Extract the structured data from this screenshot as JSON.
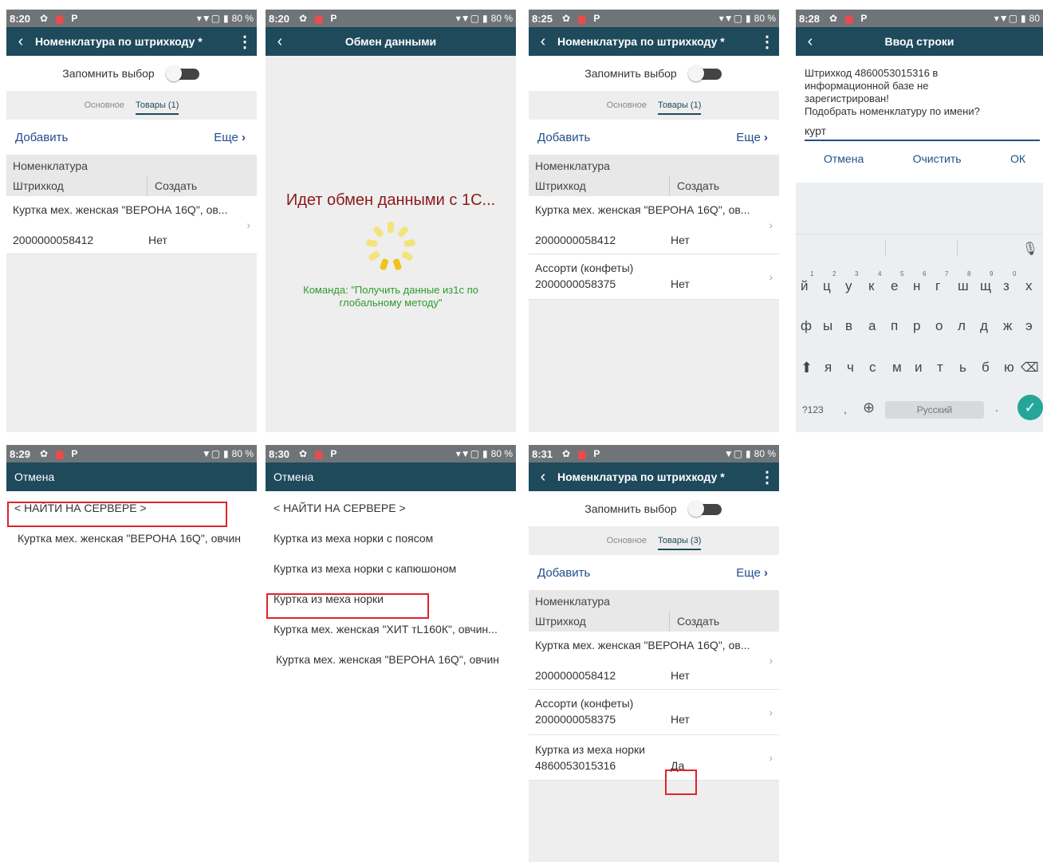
{
  "panel1": {
    "status": {
      "time": "8:20",
      "battery": "80 %"
    },
    "title": "Номенклатура по штрихкоду *",
    "remember_label": "Запомнить выбор",
    "tab_main": "Основное",
    "tab_goods": "Товары (1)",
    "add": "Добавить",
    "more": "Еще",
    "col_header1": "Номенклатура",
    "col_barcode": "Штрихкод",
    "col_create": "Создать",
    "rows": [
      {
        "name": "Куртка мех. женская \"ВЕРОНА 16Q\", ов...",
        "barcode": "2000000058412",
        "create": "Нет"
      }
    ]
  },
  "panel2": {
    "status": {
      "time": "8:20",
      "battery": "80 %"
    },
    "title": "Обмен данными",
    "message": "Идет обмен данными с 1С...",
    "command_line1": "Команда: \"Получить данные из1с по",
    "command_line2": "глобальному методу\""
  },
  "panel3": {
    "status": {
      "time": "8:25",
      "battery": "80 %"
    },
    "title": "Номенклатура по штрихкоду *",
    "remember_label": "Запомнить выбор",
    "tab_main": "Основное",
    "tab_goods": "Товары (1)",
    "add": "Добавить",
    "more": "Еще",
    "col_header1": "Номенклатура",
    "col_barcode": "Штрихкод",
    "col_create": "Создать",
    "rows": [
      {
        "name": "Куртка мех. женская \"ВЕРОНА 16Q\", ов...",
        "barcode": "2000000058412",
        "create": "Нет"
      },
      {
        "name": "Ассорти (конфеты)",
        "barcode": "2000000058375",
        "create": "Нет"
      }
    ]
  },
  "panel4": {
    "status": {
      "time": "8:28",
      "battery": "80"
    },
    "title": "Ввод строки",
    "message_lines": [
      "Штрихкод 4860053015316 в",
      "информационной базе не",
      "зарегистрирован!",
      "Подобрать номенклатуру по имени?"
    ],
    "input_value": "курт",
    "cancel": "Отмена",
    "clear": "Очистить",
    "ok": "ОК",
    "keyboard": {
      "row1": [
        "й",
        "ц",
        "у",
        "к",
        "е",
        "н",
        "г",
        "ш",
        "щ",
        "з",
        "х"
      ],
      "row1_nums": [
        "1",
        "2",
        "3",
        "4",
        "5",
        "6",
        "7",
        "8",
        "9",
        "0"
      ],
      "row2": [
        "ф",
        "ы",
        "в",
        "а",
        "п",
        "р",
        "о",
        "л",
        "д",
        "ж",
        "э"
      ],
      "row3": [
        "я",
        "ч",
        "с",
        "м",
        "и",
        "т",
        "ь",
        "б",
        "ю"
      ],
      "sym": "?123",
      "comma": ",",
      "space": "Русский",
      "period": "."
    }
  },
  "panel5": {
    "status": {
      "time": "8:29",
      "battery": "80 %"
    },
    "cancel": "Отмена",
    "items": [
      "< НАЙТИ НА СЕРВЕРЕ >",
      "Куртка мех. женская \"ВЕРОНА 16Q\", овчин"
    ]
  },
  "panel6": {
    "status": {
      "time": "8:30",
      "battery": "80 %"
    },
    "cancel": "Отмена",
    "items": [
      "< НАЙТИ НА СЕРВЕРЕ >",
      "Куртка из меха норки с поясом",
      "Куртка из меха норки с капюшоном",
      "Куртка из меха норки",
      "Куртка мех. женская \"ХИТ тL160К\", овчин...",
      "Куртка мех. женская \"ВЕРОНА 16Q\", овчин"
    ]
  },
  "panel7": {
    "status": {
      "time": "8:31",
      "battery": "80 %"
    },
    "title": "Номенклатура по штрихкоду *",
    "remember_label": "Запомнить выбор",
    "tab_main": "Основное",
    "tab_goods": "Товары (3)",
    "add": "Добавить",
    "more": "Еще",
    "col_header1": "Номенклатура",
    "col_barcode": "Штрихкод",
    "col_create": "Создать",
    "rows": [
      {
        "name": "Куртка мех. женская \"ВЕРОНА 16Q\", ов...",
        "barcode": "2000000058412",
        "create": "Нет"
      },
      {
        "name": "Ассорти (конфеты)",
        "barcode": "2000000058375",
        "create": "Нет"
      },
      {
        "name": "Куртка из меха норки",
        "barcode": "4860053015316",
        "create": "Да"
      }
    ]
  },
  "colors": {
    "appbar": "#1e4a5c",
    "statusbar": "#6f7478",
    "link": "#1f4e8c",
    "highlight": "#e0232b",
    "exchange_text": "#8b1a1a",
    "command_text": "#2e9a2e"
  }
}
